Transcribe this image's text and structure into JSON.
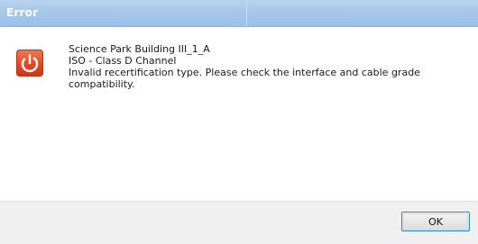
{
  "dialog": {
    "title": "Error",
    "icon": "error-power-icon",
    "messages": [
      "Science Park Building III_1_A",
      "ISO - Class D Channel",
      "Invalid recertification type. Please check the interface and cable grade compatibility."
    ],
    "ok_label": "OK"
  },
  "colors": {
    "titlebar": "#a6c7ea",
    "icon_red": "#e14a24",
    "footer": "#f0f0f0",
    "button_border": "#3c7fb1"
  }
}
